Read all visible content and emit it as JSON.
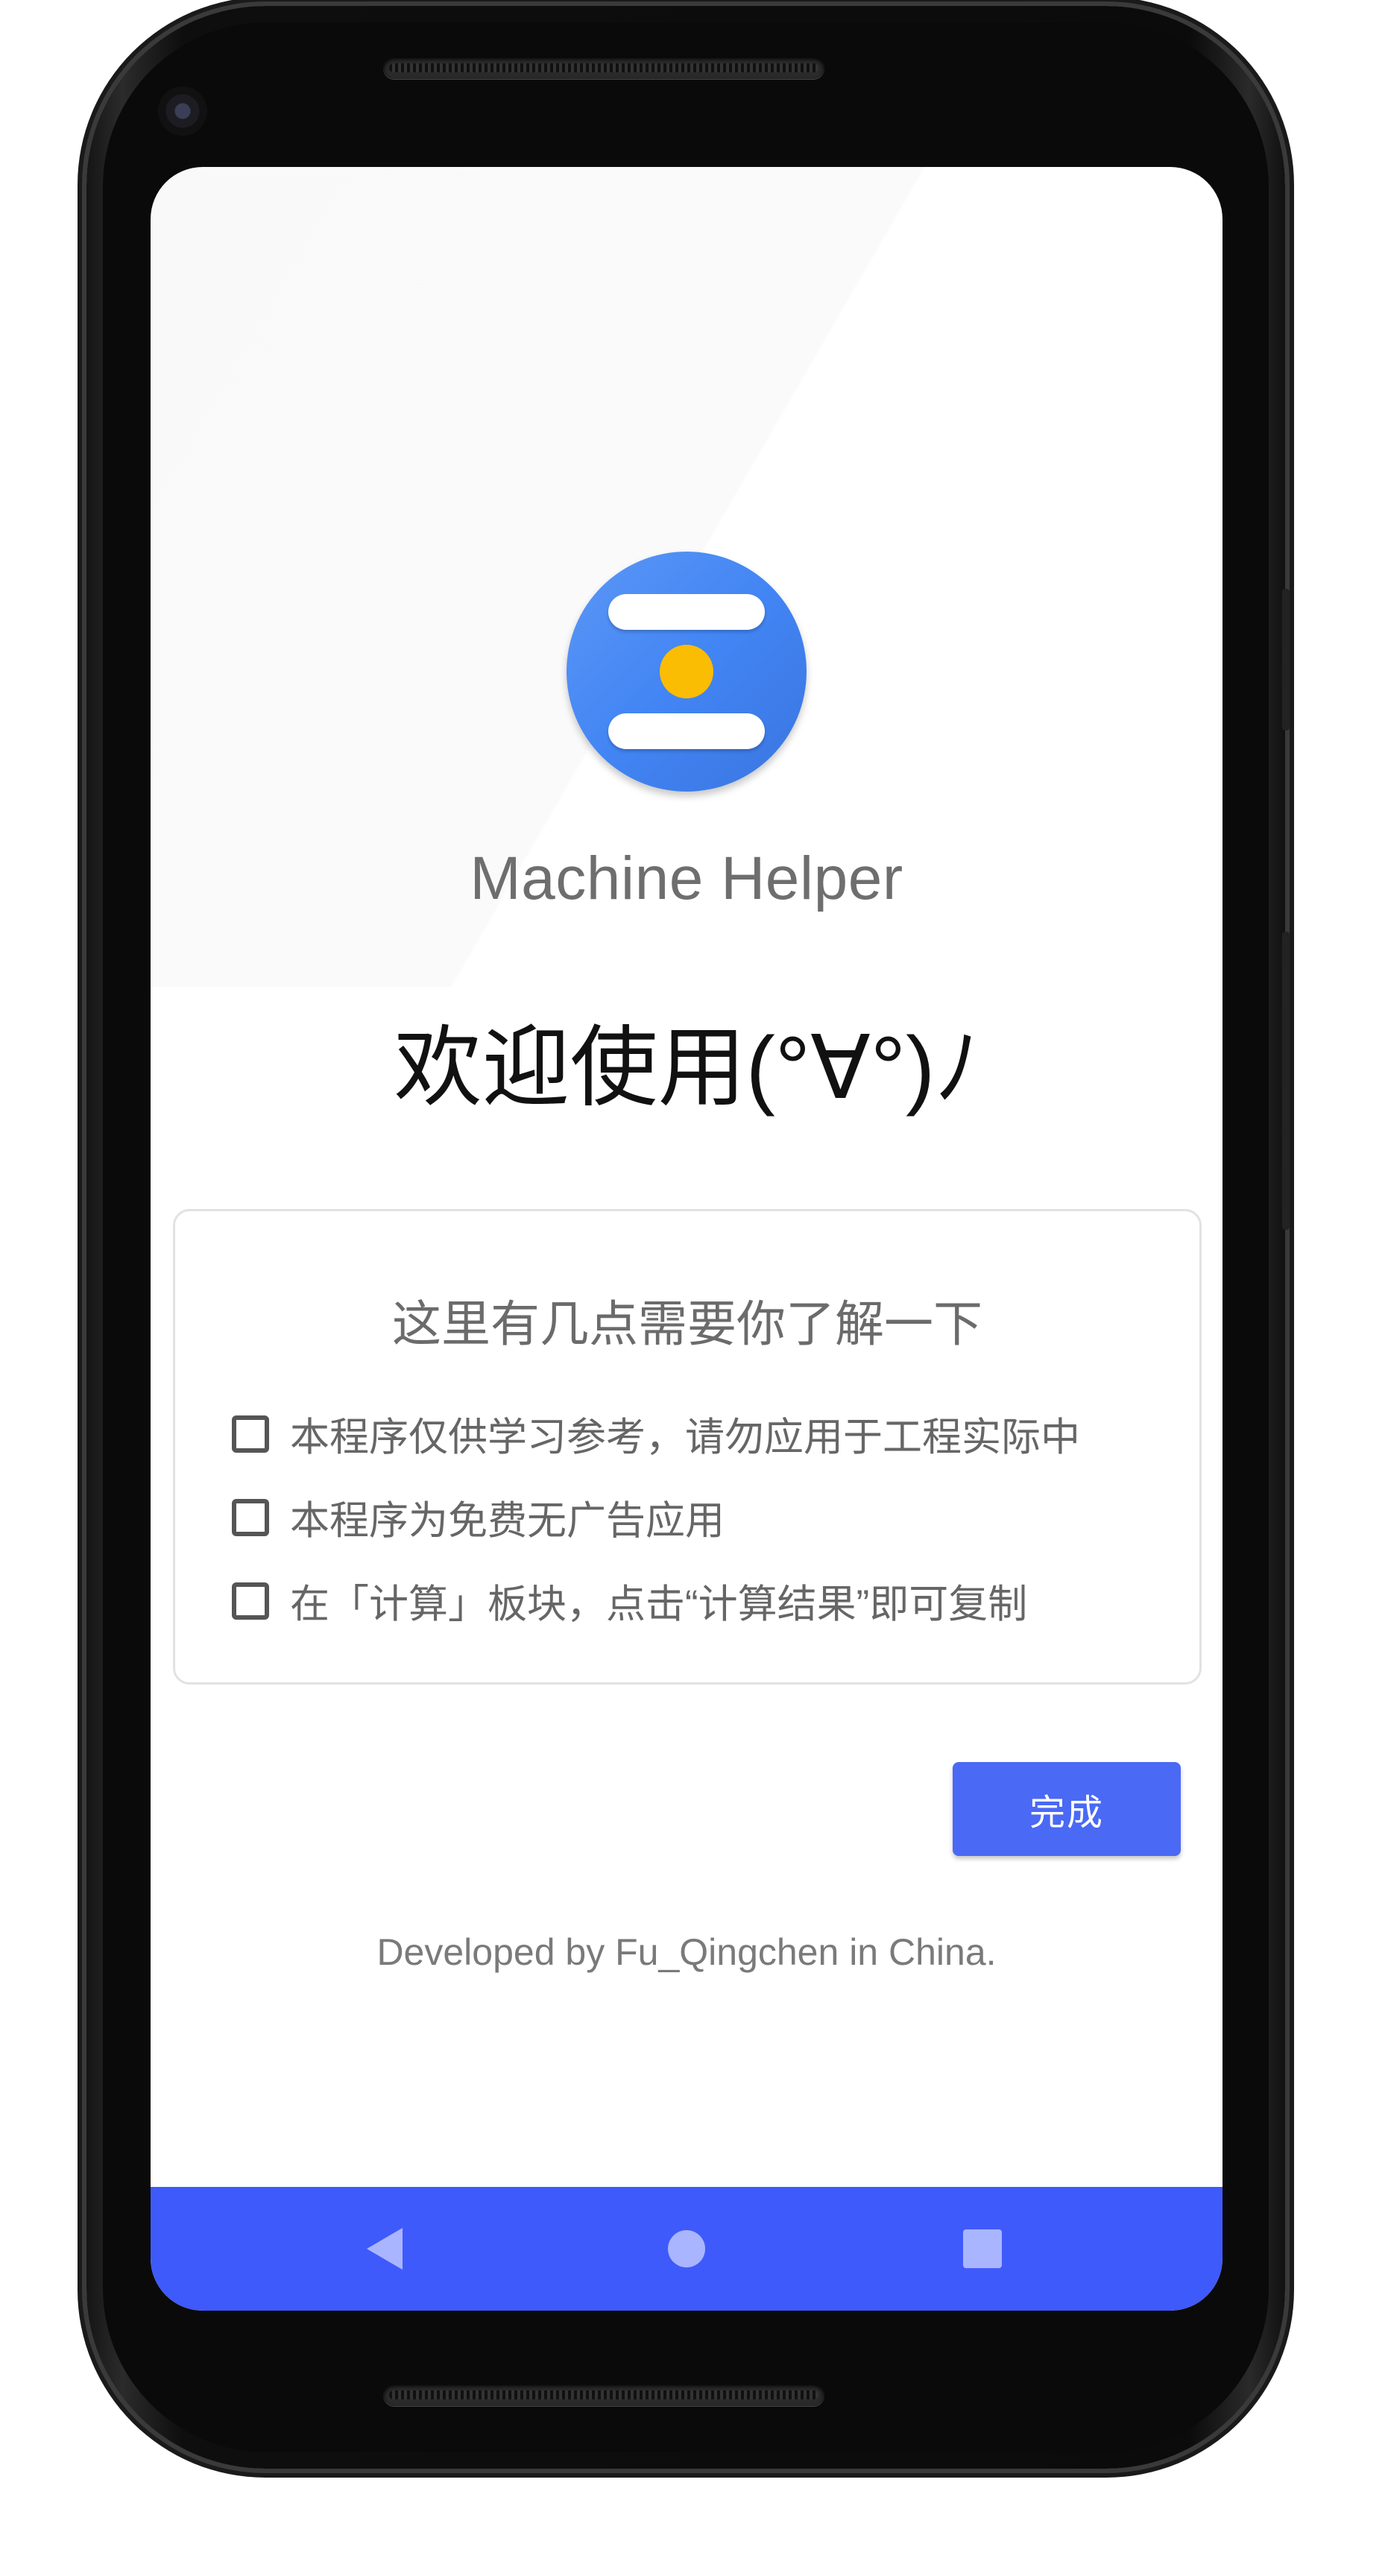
{
  "app": {
    "name": "Machine Helper",
    "welcome": "欢迎使用(°∀°)ﾉ"
  },
  "notice_card": {
    "title": "这里有几点需要你了解一下",
    "items": [
      {
        "label": "本程序仅供学习参考，请勿应用于工程实际中",
        "checked": false
      },
      {
        "label": "本程序为免费无广告应用",
        "checked": false
      },
      {
        "label": "在「计算」板块，点击“计算结果”即可复制",
        "checked": false
      }
    ]
  },
  "done_button": {
    "label": "完成"
  },
  "footer": {
    "text": "Developed by Fu_Qingchen in China."
  },
  "navigation": {
    "back_icon": "back-triangle-icon",
    "home_icon": "home-circle-icon",
    "recents_icon": "recents-square-icon"
  },
  "colors": {
    "accent": "#4a69f5",
    "nav_bar": "#3f5afa",
    "icon_blue": "#4285f4",
    "icon_yellow": "#fbbc04"
  }
}
